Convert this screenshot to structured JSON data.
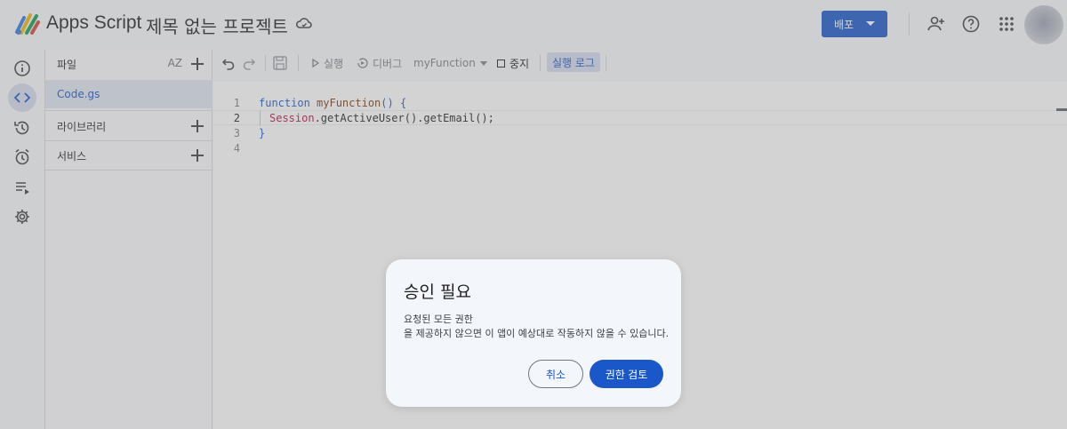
{
  "header": {
    "app_name": "Apps Script",
    "project_title": "제목 없는 프로젝트",
    "deploy_label": "배포"
  },
  "rail": {
    "items": [
      {
        "name": "overview",
        "icon": "info-icon"
      },
      {
        "name": "editor",
        "icon": "code-icon",
        "active": true
      },
      {
        "name": "executions",
        "icon": "history-icon"
      },
      {
        "name": "triggers",
        "icon": "alarm-icon"
      },
      {
        "name": "executions-list",
        "icon": "playlist-icon"
      },
      {
        "name": "settings",
        "icon": "gear-icon"
      }
    ]
  },
  "files_panel": {
    "files_label": "파일",
    "sort_label": "AZ",
    "file_name": "Code.gs",
    "libraries_label": "라이브러리",
    "services_label": "서비스"
  },
  "toolbar": {
    "run_label": "실행",
    "debug_label": "디버그",
    "function_name": "myFunction",
    "stop_label": "중지",
    "log_label": "실행 로그"
  },
  "editor": {
    "line_numbers": [
      "1",
      "2",
      "3",
      "4"
    ],
    "line1_kw": "function",
    "line1_fn": "myFunction",
    "line1_rest": "() {",
    "line2_obj": "Session",
    "line2_rest": ".getActiveUser().getEmail();",
    "line3": "}"
  },
  "dialog": {
    "title": "승인 필요",
    "body_line1": "요청된 모든 권한",
    "body_line2": "을 제공하지 않으면 이 앱이 예상대로 작동하지 않을 수 있습니다.",
    "cancel_label": "취소",
    "review_label": "권한 검토"
  },
  "colors": {
    "accent": "#1a57c9",
    "background": "#f8f9fc"
  }
}
